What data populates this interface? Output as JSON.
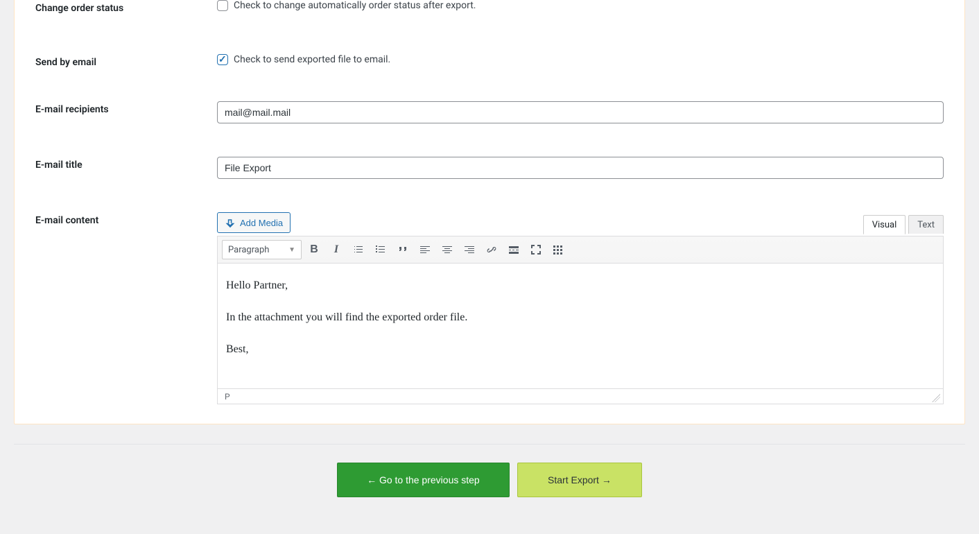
{
  "form": {
    "change_order_status": {
      "label": "Change order status",
      "checked": false,
      "desc": "Check to change automatically order status after export."
    },
    "send_by_email": {
      "label": "Send by email",
      "checked": true,
      "desc": "Check to send exported file to email."
    },
    "recipients": {
      "label": "E-mail recipients",
      "value": "mail@mail.mail"
    },
    "title": {
      "label": "E-mail title",
      "value": "File Export"
    },
    "content": {
      "label": "E-mail content",
      "add_media": "Add Media",
      "tab_visual": "Visual",
      "tab_text": "Text",
      "paragraph_label": "Paragraph",
      "body_p1": "Hello Partner,",
      "body_p2": "In the attachment you will find the exported order file.",
      "body_p3": "Best,",
      "status_path": "P"
    }
  },
  "buttons": {
    "prev": "← Go to the previous step",
    "start": "Start Export →"
  }
}
